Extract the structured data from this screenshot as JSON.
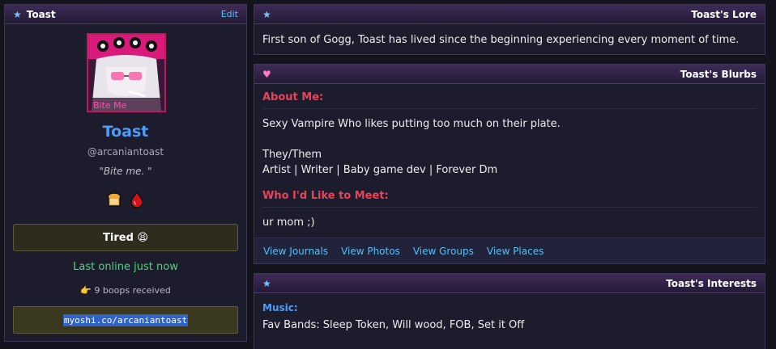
{
  "profile": {
    "header_title": "Toast",
    "edit_label": "Edit",
    "avatar_caption": "Bite Me",
    "display_name": "Toast",
    "handle": "@arcaniantoast",
    "tagline": "\"Bite me. \"",
    "badges": [
      "bread-icon",
      "blood-drop-icon"
    ],
    "mood": "Tired 😫",
    "last_online": "Last online just now",
    "boops": "👉 9 boops received",
    "url": "myoshi.co/arcaniantoast"
  },
  "lore": {
    "title": "Toast's Lore",
    "text": "First son of Gogg, Toast has lived since the beginning experiencing every moment of time."
  },
  "blurbs": {
    "title": "Toast's Blurbs",
    "about_heading": "About Me:",
    "about_line1": "Sexy Vampire Who likes putting too much on their plate.",
    "about_line2": "They/Them",
    "about_line3": "Artist | Writer | Baby game dev | Forever Dm",
    "meet_heading": "Who I'd Like to Meet:",
    "meet_text": "ur mom ;)",
    "links": [
      "View Journals",
      "View Photos",
      "View Groups",
      "View Places"
    ]
  },
  "interests": {
    "title": "Toast's Interests",
    "music_heading": "Music:",
    "music_text": "Fav Bands: Sleep Token, Will wood, FOB, Set it Off"
  },
  "colors": {
    "accent_blue": "#4f9cf5",
    "link_blue": "#4fc3f7",
    "heading_red": "#e8435a",
    "online_green": "#48d97a",
    "header_purple": "#3e2b57"
  }
}
